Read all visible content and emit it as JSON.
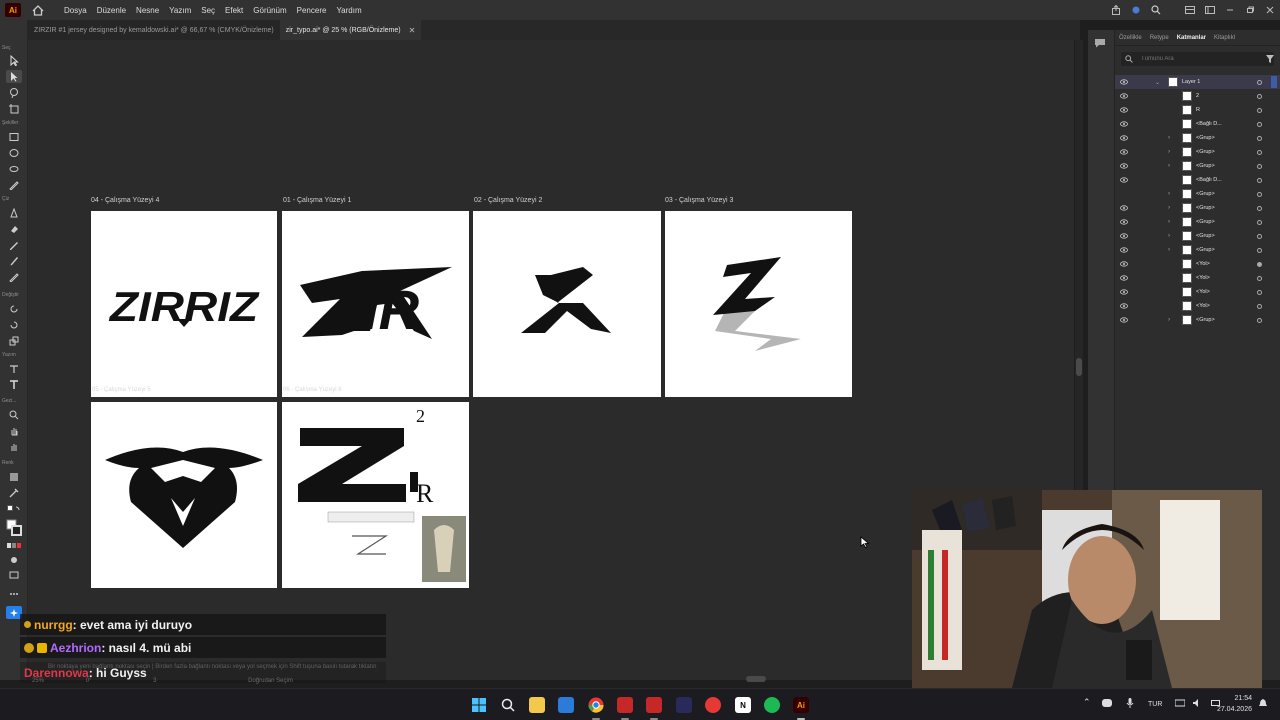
{
  "app": {
    "logo_text": "Ai",
    "menus": [
      "Dosya",
      "Düzenle",
      "Nesne",
      "Yazım",
      "Seç",
      "Efekt",
      "Görünüm",
      "Pencere",
      "Yardım"
    ]
  },
  "tabs": [
    {
      "label": "ZIRZIR #1 jersey designed by kemaldowski.ai* @ 66,67 % (CMYK/Önizleme)"
    },
    {
      "label": "zir_typo.ai* @ 25 % (RGB/Önizleme)"
    }
  ],
  "toolbar": {
    "section_labels": [
      "Seç",
      "Şekiller",
      "Çiz",
      "Değiştir",
      "Yazım",
      "Gezi...",
      "Renk"
    ]
  },
  "artboards": [
    {
      "label": "04 - Çalışma Yüzeyi 4"
    },
    {
      "label": "01 - Çalışma Yüzeyi 1"
    },
    {
      "label": "02 - Çalışma Yüzeyi 2"
    },
    {
      "label": "03 - Çalışma Yüzeyi 3"
    },
    {
      "label": "05 - Çalışma Yüzeyi 5"
    },
    {
      "label": "06 - Çalışma Yüzeyi 6"
    }
  ],
  "artwork": {
    "ab1_text": "ZIRRIZ",
    "ab2_text": "ZIR",
    "ab6_sup": "2",
    "ab6_r": "R",
    "ab6_sketch": "Zir"
  },
  "panel": {
    "tabs": [
      "Özellikle",
      "Retype",
      "Katmanlar",
      "Kitaplıkl"
    ],
    "active_tab": "Katmanlar",
    "search_placeholder": "Tümünü Ara",
    "layers": [
      {
        "name": "Layer 1"
      },
      {
        "name": "2"
      },
      {
        "name": "R"
      },
      {
        "name": "<Bağlı D..."
      },
      {
        "name": "<Grup>"
      },
      {
        "name": "<Grup>"
      },
      {
        "name": "<Grup>"
      },
      {
        "name": "<Bağlı D..."
      },
      {
        "name": "<Grup>"
      },
      {
        "name": "<Grup>"
      },
      {
        "name": "<Grup>"
      },
      {
        "name": "<Grup>"
      },
      {
        "name": "<Grup>"
      },
      {
        "name": "<Yol>"
      },
      {
        "name": "<Yol>"
      },
      {
        "name": "<Yol>"
      },
      {
        "name": "<Yol>"
      },
      {
        "name": "<Grup>"
      }
    ]
  },
  "chat": [
    {
      "user": "nurrgg",
      "message": " : evet ama iyi duruyo",
      "color": "#f5a623"
    },
    {
      "user": "Aezhrion",
      "message": " : nasıl 4. mü abi",
      "color": "#b36bff"
    },
    {
      "user": "Darennowa",
      "message": " : hi Guyss",
      "color": "#e0384b"
    }
  ],
  "status": {
    "hint": "Bir noktaya yeni bağlantı noktası seçin  |  Birden fazla bağlantı noktası veya yol seçmek için Shift tuşuna basılı tutarak tıklatın",
    "zoom": "25%",
    "rotation": "0°",
    "page": "3",
    "mode": "Doğrudan Seçim"
  },
  "taskbar": {
    "lang": "TUR",
    "time": "21:54",
    "date": "27.04.2026",
    "ai_label": "Ai"
  },
  "colors": {
    "accent": "#3e5da8",
    "ai_orange": "#ff9a00",
    "ai_bg": "#330000"
  }
}
